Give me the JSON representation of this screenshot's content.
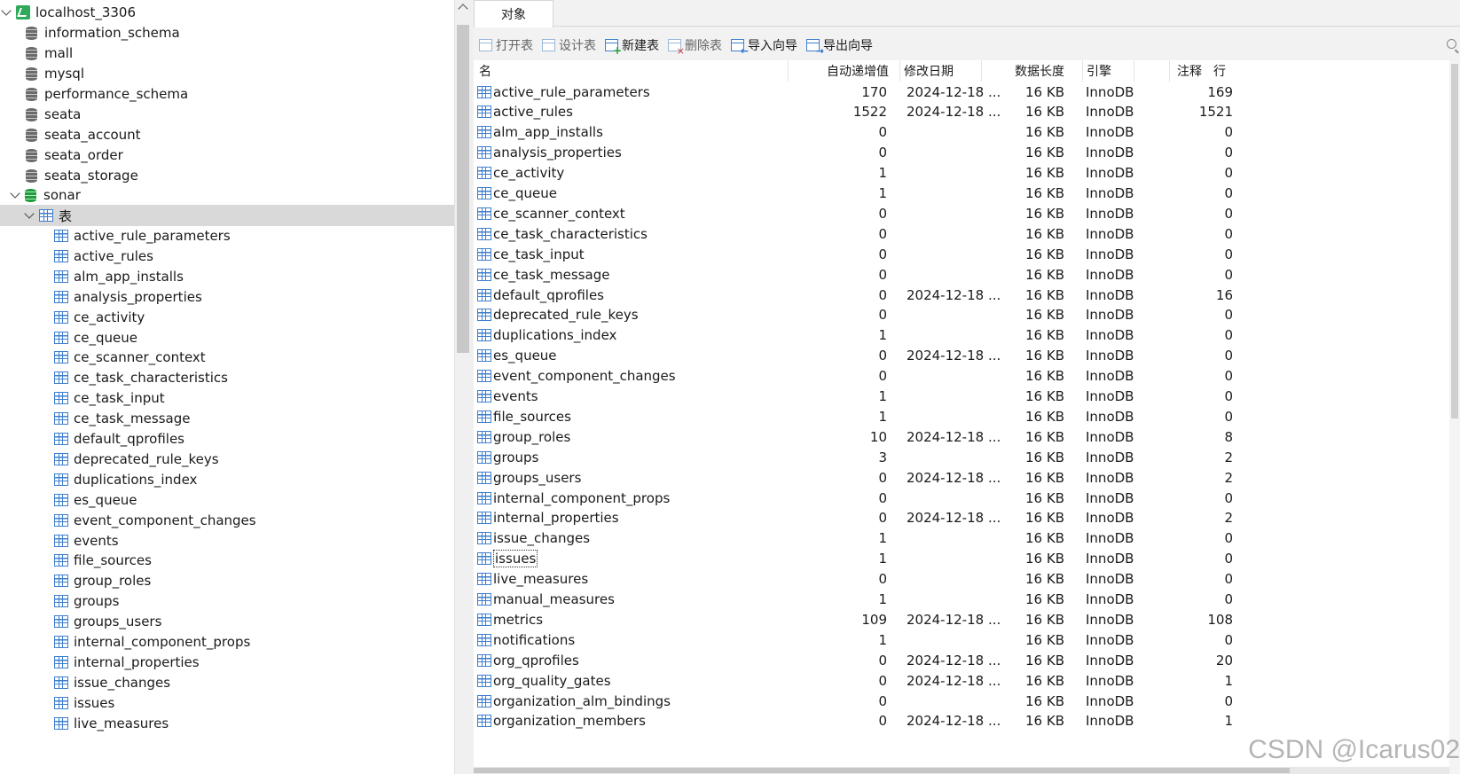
{
  "tree": {
    "connection": "localhost_3306",
    "databases": [
      "information_schema",
      "mall",
      "mysql",
      "performance_schema",
      "seata",
      "seata_account",
      "seata_order",
      "seata_storage"
    ],
    "open_database": "sonar",
    "tables_folder": "表",
    "tables": [
      "active_rule_parameters",
      "active_rules",
      "alm_app_installs",
      "analysis_properties",
      "ce_activity",
      "ce_queue",
      "ce_scanner_context",
      "ce_task_characteristics",
      "ce_task_input",
      "ce_task_message",
      "default_qprofiles",
      "deprecated_rule_keys",
      "duplications_index",
      "es_queue",
      "event_component_changes",
      "events",
      "file_sources",
      "group_roles",
      "groups",
      "groups_users",
      "internal_component_props",
      "internal_properties",
      "issue_changes",
      "issues",
      "live_measures"
    ]
  },
  "tabs": {
    "objects": "对象"
  },
  "toolbar": {
    "open_table": "打开表",
    "design_table": "设计表",
    "new_table": "新建表",
    "delete_table": "删除表",
    "import_wizard": "导入向导",
    "export_wizard": "导出向导"
  },
  "grid": {
    "columns": {
      "name": "名",
      "auto_increment": "自动递增值",
      "modified": "修改日期",
      "data_length": "数据长度",
      "engine": "引擎",
      "rows": "行",
      "comment": "注释"
    },
    "rows": [
      {
        "name": "active_rule_parameters",
        "ai": "170",
        "date": "2024-12-18 ...",
        "len": "16 KB",
        "eng": "InnoDB",
        "rows": "169"
      },
      {
        "name": "active_rules",
        "ai": "1522",
        "date": "2024-12-18 ...",
        "len": "16 KB",
        "eng": "InnoDB",
        "rows": "1521"
      },
      {
        "name": "alm_app_installs",
        "ai": "0",
        "date": "",
        "len": "16 KB",
        "eng": "InnoDB",
        "rows": "0"
      },
      {
        "name": "analysis_properties",
        "ai": "0",
        "date": "",
        "len": "16 KB",
        "eng": "InnoDB",
        "rows": "0"
      },
      {
        "name": "ce_activity",
        "ai": "1",
        "date": "",
        "len": "16 KB",
        "eng": "InnoDB",
        "rows": "0"
      },
      {
        "name": "ce_queue",
        "ai": "1",
        "date": "",
        "len": "16 KB",
        "eng": "InnoDB",
        "rows": "0"
      },
      {
        "name": "ce_scanner_context",
        "ai": "0",
        "date": "",
        "len": "16 KB",
        "eng": "InnoDB",
        "rows": "0"
      },
      {
        "name": "ce_task_characteristics",
        "ai": "0",
        "date": "",
        "len": "16 KB",
        "eng": "InnoDB",
        "rows": "0"
      },
      {
        "name": "ce_task_input",
        "ai": "0",
        "date": "",
        "len": "16 KB",
        "eng": "InnoDB",
        "rows": "0"
      },
      {
        "name": "ce_task_message",
        "ai": "0",
        "date": "",
        "len": "16 KB",
        "eng": "InnoDB",
        "rows": "0"
      },
      {
        "name": "default_qprofiles",
        "ai": "0",
        "date": "2024-12-18 ...",
        "len": "16 KB",
        "eng": "InnoDB",
        "rows": "16"
      },
      {
        "name": "deprecated_rule_keys",
        "ai": "0",
        "date": "",
        "len": "16 KB",
        "eng": "InnoDB",
        "rows": "0"
      },
      {
        "name": "duplications_index",
        "ai": "1",
        "date": "",
        "len": "16 KB",
        "eng": "InnoDB",
        "rows": "0"
      },
      {
        "name": "es_queue",
        "ai": "0",
        "date": "2024-12-18 ...",
        "len": "16 KB",
        "eng": "InnoDB",
        "rows": "0"
      },
      {
        "name": "event_component_changes",
        "ai": "0",
        "date": "",
        "len": "16 KB",
        "eng": "InnoDB",
        "rows": "0"
      },
      {
        "name": "events",
        "ai": "1",
        "date": "",
        "len": "16 KB",
        "eng": "InnoDB",
        "rows": "0"
      },
      {
        "name": "file_sources",
        "ai": "1",
        "date": "",
        "len": "16 KB",
        "eng": "InnoDB",
        "rows": "0"
      },
      {
        "name": "group_roles",
        "ai": "10",
        "date": "2024-12-18 ...",
        "len": "16 KB",
        "eng": "InnoDB",
        "rows": "8"
      },
      {
        "name": "groups",
        "ai": "3",
        "date": "",
        "len": "16 KB",
        "eng": "InnoDB",
        "rows": "2"
      },
      {
        "name": "groups_users",
        "ai": "0",
        "date": "2024-12-18 ...",
        "len": "16 KB",
        "eng": "InnoDB",
        "rows": "2"
      },
      {
        "name": "internal_component_props",
        "ai": "0",
        "date": "",
        "len": "16 KB",
        "eng": "InnoDB",
        "rows": "0"
      },
      {
        "name": "internal_properties",
        "ai": "0",
        "date": "2024-12-18 ...",
        "len": "16 KB",
        "eng": "InnoDB",
        "rows": "2"
      },
      {
        "name": "issue_changes",
        "ai": "1",
        "date": "",
        "len": "16 KB",
        "eng": "InnoDB",
        "rows": "0"
      },
      {
        "name": "issues",
        "ai": "1",
        "date": "",
        "len": "16 KB",
        "eng": "InnoDB",
        "rows": "0"
      },
      {
        "name": "live_measures",
        "ai": "0",
        "date": "",
        "len": "16 KB",
        "eng": "InnoDB",
        "rows": "0"
      },
      {
        "name": "manual_measures",
        "ai": "1",
        "date": "",
        "len": "16 KB",
        "eng": "InnoDB",
        "rows": "0"
      },
      {
        "name": "metrics",
        "ai": "109",
        "date": "2024-12-18 ...",
        "len": "16 KB",
        "eng": "InnoDB",
        "rows": "108"
      },
      {
        "name": "notifications",
        "ai": "1",
        "date": "",
        "len": "16 KB",
        "eng": "InnoDB",
        "rows": "0"
      },
      {
        "name": "org_qprofiles",
        "ai": "0",
        "date": "2024-12-18 ...",
        "len": "16 KB",
        "eng": "InnoDB",
        "rows": "20"
      },
      {
        "name": "org_quality_gates",
        "ai": "0",
        "date": "2024-12-18 ...",
        "len": "16 KB",
        "eng": "InnoDB",
        "rows": "1"
      },
      {
        "name": "organization_alm_bindings",
        "ai": "0",
        "date": "",
        "len": "16 KB",
        "eng": "InnoDB",
        "rows": "0"
      },
      {
        "name": "organization_members",
        "ai": "0",
        "date": "2024-12-18 ...",
        "len": "16 KB",
        "eng": "InnoDB",
        "rows": "1"
      }
    ],
    "focused_row": "issues"
  },
  "watermark": "CSDN @Icarus02"
}
